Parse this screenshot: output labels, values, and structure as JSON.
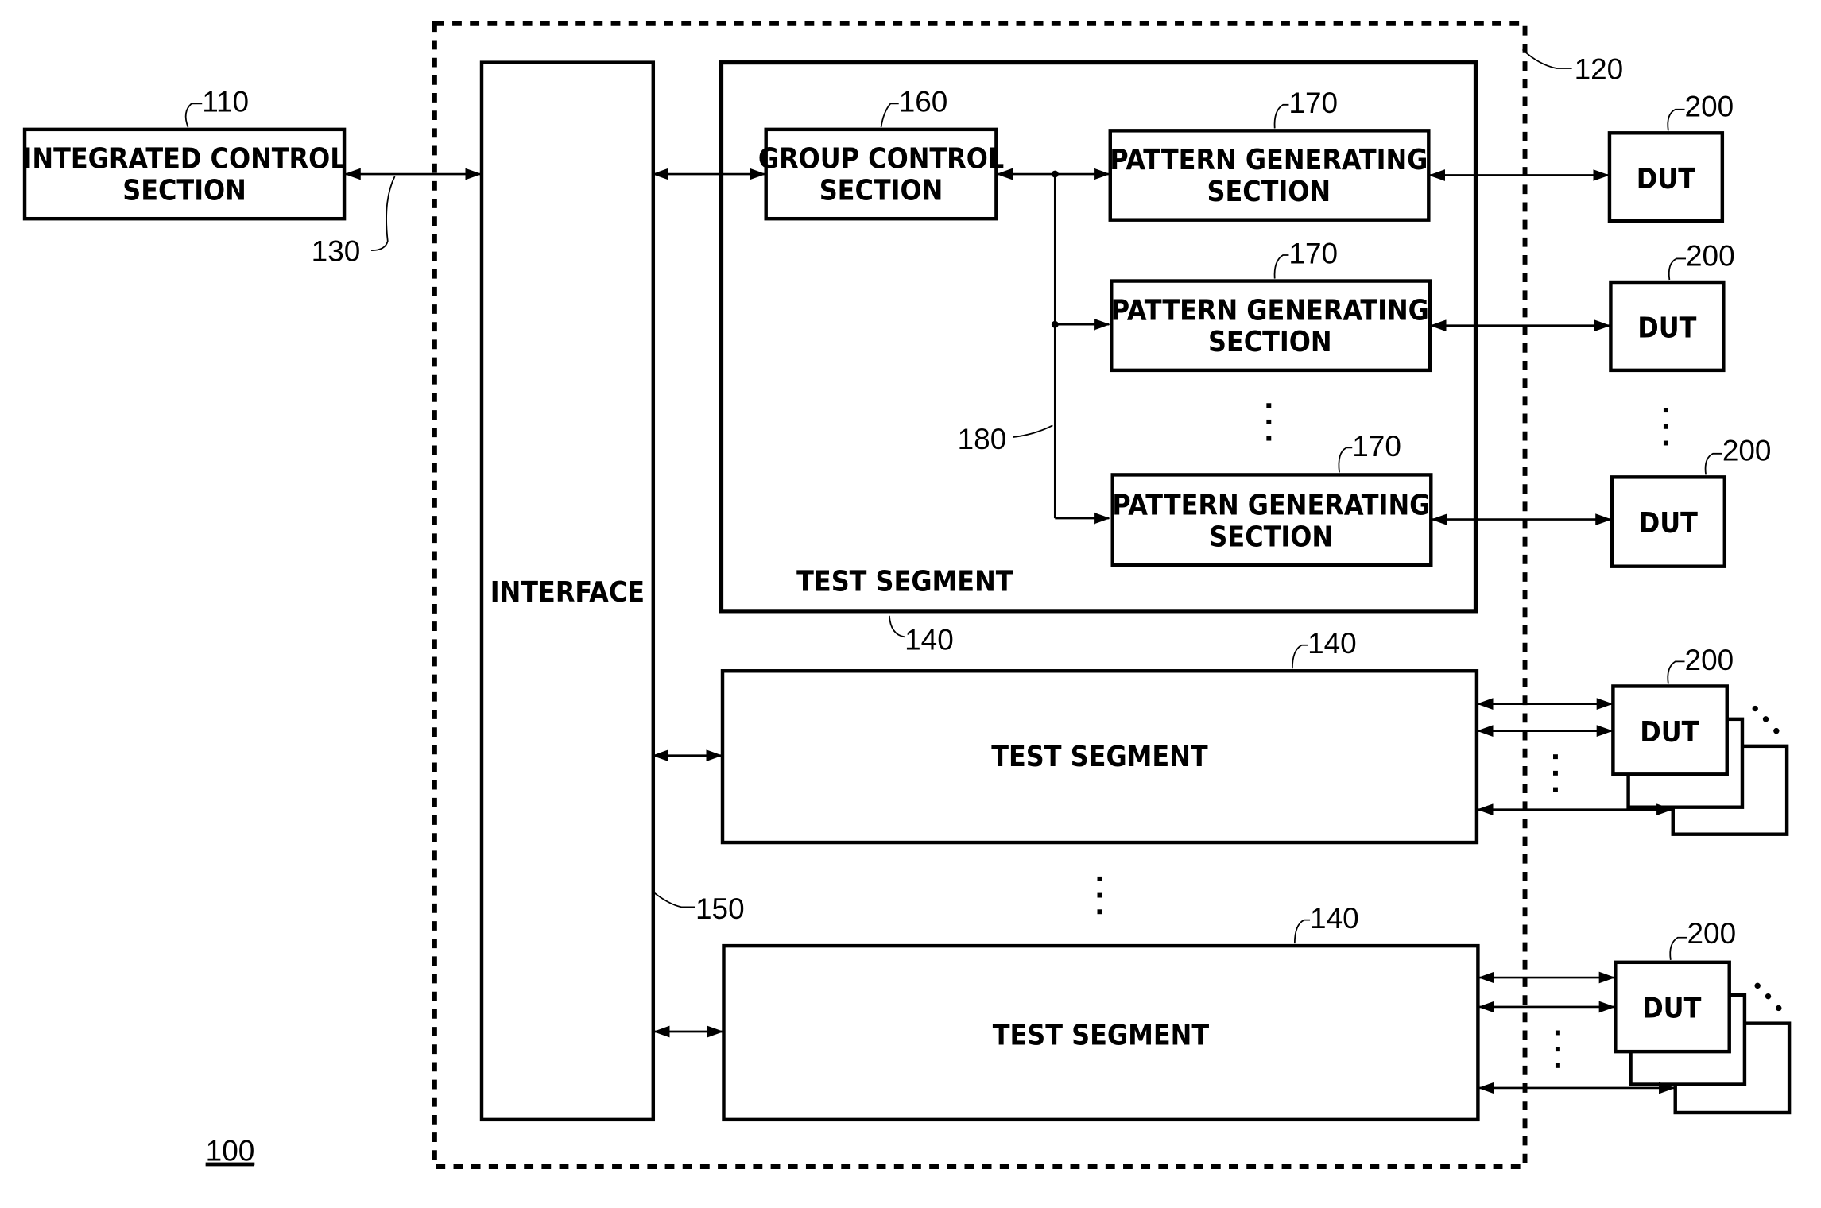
{
  "figure": {
    "system_ref": "100",
    "tester_ref": "120",
    "bus_ref": "130",
    "interface_bus_ref": "150",
    "internal_bus_ref": "180"
  },
  "integrated_control": {
    "ref": "110",
    "line1": "INTEGRATED CONTROL",
    "line2": "SECTION"
  },
  "interface": {
    "label": "INTERFACE"
  },
  "test_segments": [
    {
      "ref": "140",
      "label": "TEST SEGMENT",
      "group_control": {
        "ref": "160",
        "line1": "GROUP CONTROL",
        "line2": "SECTION"
      },
      "pattern_generators": [
        {
          "ref": "170",
          "line1": "PATTERN GENERATING",
          "line2": "SECTION"
        },
        {
          "ref": "170",
          "line1": "PATTERN GENERATING",
          "line2": "SECTION"
        },
        {
          "ref": "170",
          "line1": "PATTERN GENERATING",
          "line2": "SECTION"
        }
      ]
    },
    {
      "ref": "140",
      "label": "TEST SEGMENT"
    },
    {
      "ref": "140",
      "label": "TEST SEGMENT"
    }
  ],
  "duts": [
    {
      "ref": "200",
      "label": "DUT"
    },
    {
      "ref": "200",
      "label": "DUT"
    },
    {
      "ref": "200",
      "label": "DUT"
    },
    {
      "ref": "200",
      "label": "DUT"
    },
    {
      "ref": "200",
      "label": "DUT"
    }
  ]
}
